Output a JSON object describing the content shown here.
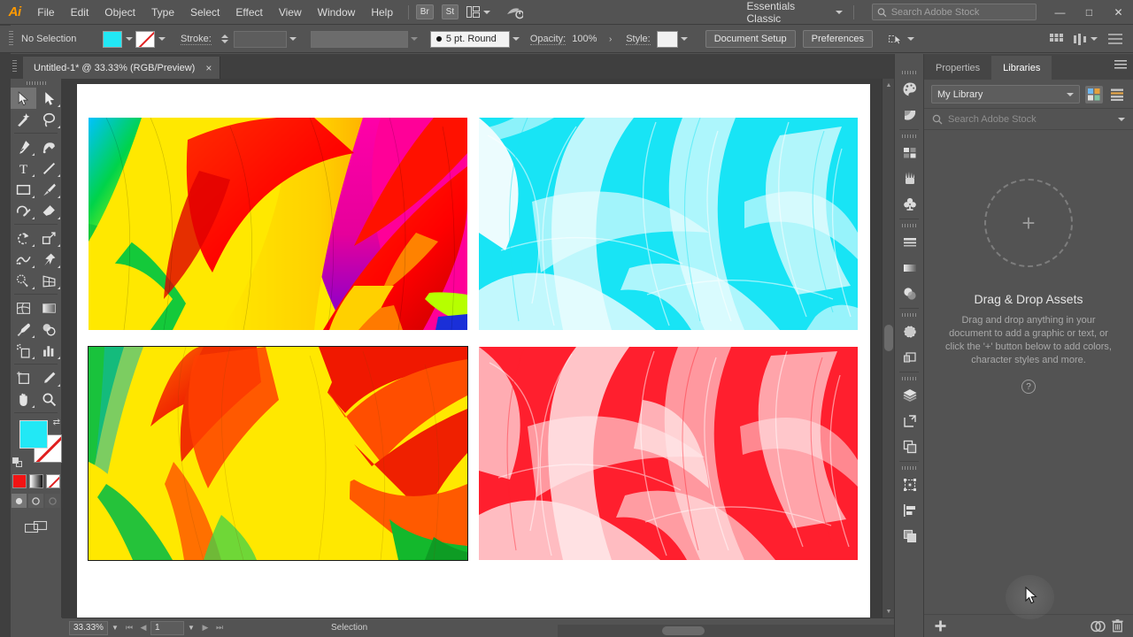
{
  "app": {
    "name": "Adobe Illustrator",
    "logo_text": "Ai",
    "accent_color": "#ff9a00",
    "ui_background": "#535353"
  },
  "menubar": {
    "items": [
      "File",
      "Edit",
      "Object",
      "Type",
      "Select",
      "Effect",
      "View",
      "Window",
      "Help"
    ],
    "bridge_label": "Br",
    "stock_label": "St",
    "workspace": "Essentials Classic",
    "search_placeholder": "Search Adobe Stock",
    "search_value": "",
    "window_controls": {
      "minimize": "—",
      "maximize": "□",
      "close": "✕"
    }
  },
  "controlbar": {
    "selection_status": "No Selection",
    "fill_color": "#22e8f5",
    "stroke_color": "none",
    "stroke_label": "Stroke:",
    "stroke_weight": "",
    "stroke_profile": "",
    "brush_definition": "5 pt. Round",
    "opacity_label": "Opacity:",
    "opacity_value": "100%",
    "style_label": "Style:",
    "document_setup": "Document Setup",
    "preferences": "Preferences"
  },
  "tabbar": {
    "document_title": "Untitled-1* @ 33.33% (RGB/Preview)",
    "close_glyph": "×"
  },
  "toolbar": {
    "tools": [
      {
        "name": "selection-tool",
        "label": "Selection",
        "active": true
      },
      {
        "name": "direct-selection-tool",
        "label": "Direct Selection",
        "active": false
      },
      {
        "name": "magic-wand-tool",
        "label": "Magic Wand",
        "active": false
      },
      {
        "name": "lasso-tool",
        "label": "Lasso",
        "active": false
      },
      {
        "name": "pen-tool",
        "label": "Pen",
        "active": false
      },
      {
        "name": "curvature-tool",
        "label": "Curvature",
        "active": false
      },
      {
        "name": "type-tool",
        "label": "Type",
        "active": false
      },
      {
        "name": "line-segment-tool",
        "label": "Line Segment",
        "active": false
      },
      {
        "name": "rectangle-tool",
        "label": "Rectangle",
        "active": false
      },
      {
        "name": "paintbrush-tool",
        "label": "Paintbrush",
        "active": false
      },
      {
        "name": "shaper-tool",
        "label": "Shaper",
        "active": false
      },
      {
        "name": "eraser-tool",
        "label": "Eraser",
        "active": false
      },
      {
        "name": "rotate-tool",
        "label": "Rotate",
        "active": false
      },
      {
        "name": "scale-tool",
        "label": "Scale",
        "active": false
      },
      {
        "name": "width-tool",
        "label": "Width",
        "active": false
      },
      {
        "name": "free-transform-tool",
        "label": "Free Transform",
        "active": false
      },
      {
        "name": "shape-builder-tool",
        "label": "Shape Builder",
        "active": false
      },
      {
        "name": "perspective-grid-tool",
        "label": "Perspective Grid",
        "active": false
      },
      {
        "name": "mesh-tool",
        "label": "Mesh",
        "active": false
      },
      {
        "name": "gradient-tool",
        "label": "Gradient",
        "active": false
      },
      {
        "name": "eyedropper-tool",
        "label": "Eyedropper",
        "active": false
      },
      {
        "name": "blend-tool",
        "label": "Blend",
        "active": false
      },
      {
        "name": "symbol-sprayer-tool",
        "label": "Symbol Sprayer",
        "active": false
      },
      {
        "name": "column-graph-tool",
        "label": "Column Graph",
        "active": false
      },
      {
        "name": "artboard-tool",
        "label": "Artboard",
        "active": false
      },
      {
        "name": "slice-tool",
        "label": "Slice",
        "active": false
      },
      {
        "name": "hand-tool",
        "label": "Hand",
        "active": false
      },
      {
        "name": "zoom-tool",
        "label": "Zoom",
        "active": false
      }
    ],
    "fill_color": "#22e8f5",
    "stroke_color": "none",
    "color_mode_color": "#f21414",
    "draw_modes": [
      "Draw Normal",
      "Draw Behind",
      "Draw Inside"
    ],
    "screen_mode": "Change Screen Mode"
  },
  "canvas": {
    "background": "#3c3c3c",
    "artboard_background": "#ffffff",
    "artworks": [
      {
        "name": "artwork-multicolor",
        "title": "Multicolor brush strokes",
        "selected": false,
        "palette": [
          "#ffe800",
          "#ff0000",
          "#ff00a0",
          "#7a00d4",
          "#00c853",
          "#00d4ff"
        ]
      },
      {
        "name": "artwork-cyan",
        "title": "Cyan brush strokes",
        "selected": false,
        "palette": [
          "#18e4f5",
          "#ffffff",
          "#9ff4fb"
        ]
      },
      {
        "name": "artwork-warm",
        "title": "Yellow orange brush strokes",
        "selected": true,
        "palette": [
          "#ffe800",
          "#ff5a00",
          "#e81000",
          "#22c13a"
        ]
      },
      {
        "name": "artwork-red",
        "title": "Red brush strokes",
        "selected": false,
        "palette": [
          "#ff1f2e",
          "#ffffff",
          "#ffb3bb"
        ]
      }
    ]
  },
  "iconrail": {
    "items": [
      {
        "name": "color-panel-icon",
        "label": "Color"
      },
      {
        "name": "color-guide-panel-icon",
        "label": "Color Guide"
      },
      {
        "name": "swatches-panel-icon",
        "label": "Swatches"
      },
      {
        "name": "brushes-panel-icon",
        "label": "Brushes"
      },
      {
        "name": "symbols-panel-icon",
        "label": "Symbols"
      },
      {
        "name": "stroke-panel-icon",
        "label": "Stroke"
      },
      {
        "name": "gradient-panel-icon",
        "label": "Gradient"
      },
      {
        "name": "transparency-panel-icon",
        "label": "Transparency"
      },
      {
        "name": "appearance-panel-icon",
        "label": "Appearance"
      },
      {
        "name": "graphic-styles-panel-icon",
        "label": "Graphic Styles"
      },
      {
        "name": "layers-panel-icon",
        "label": "Layers"
      },
      {
        "name": "artboards-panel-icon",
        "label": "Artboards"
      },
      {
        "name": "links-panel-icon",
        "label": "Links"
      },
      {
        "name": "transform-panel-icon",
        "label": "Transform"
      },
      {
        "name": "align-panel-icon",
        "label": "Align"
      },
      {
        "name": "pathfinder-panel-icon",
        "label": "Pathfinder"
      }
    ]
  },
  "libraries_panel": {
    "tabs": [
      {
        "name": "tab-properties",
        "label": "Properties",
        "active": false
      },
      {
        "name": "tab-libraries",
        "label": "Libraries",
        "active": true
      }
    ],
    "library_select": "My Library",
    "view_grid_active": true,
    "search_placeholder": "Search Adobe Stock",
    "search_value": "",
    "empty_title": "Drag & Drop Assets",
    "empty_description": "Drag and drop anything in your document to add a graphic or text, or click the '+' button below to add colors, character styles and more.",
    "help_glyph": "?",
    "add_label": "+",
    "footer_icons": [
      "add-asset-icon",
      "creative-cloud-sync-icon",
      "delete-icon"
    ]
  },
  "statusbar": {
    "zoom_level": "33.33%",
    "page_number": "1",
    "current_tool": "Selection"
  }
}
